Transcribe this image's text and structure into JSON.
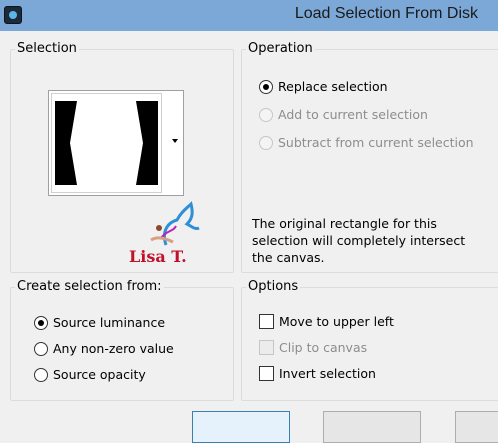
{
  "window": {
    "title": "Load Selection From Disk",
    "icon": "app-icon"
  },
  "selection": {
    "label": "Selection",
    "signature_text": "Lisa T."
  },
  "operation": {
    "label": "Operation",
    "options": [
      {
        "label": "Replace selection",
        "checked": true,
        "disabled": false
      },
      {
        "label": "Add to current selection",
        "checked": false,
        "disabled": true
      },
      {
        "label": "Subtract from current selection",
        "checked": false,
        "disabled": true
      }
    ],
    "info": "The original rectangle for this selection will completely intersect the canvas."
  },
  "create_from": {
    "label": "Create selection from:",
    "options": [
      {
        "label": "Source luminance",
        "checked": true
      },
      {
        "label": "Any non-zero value",
        "checked": false
      },
      {
        "label": "Source opacity",
        "checked": false
      }
    ]
  },
  "options": {
    "label": "Options",
    "items": [
      {
        "label": "Move to upper left",
        "checked": false,
        "disabled": false
      },
      {
        "label": "Clip to canvas",
        "checked": false,
        "disabled": true
      },
      {
        "label": "Invert selection",
        "checked": false,
        "disabled": false
      }
    ]
  }
}
